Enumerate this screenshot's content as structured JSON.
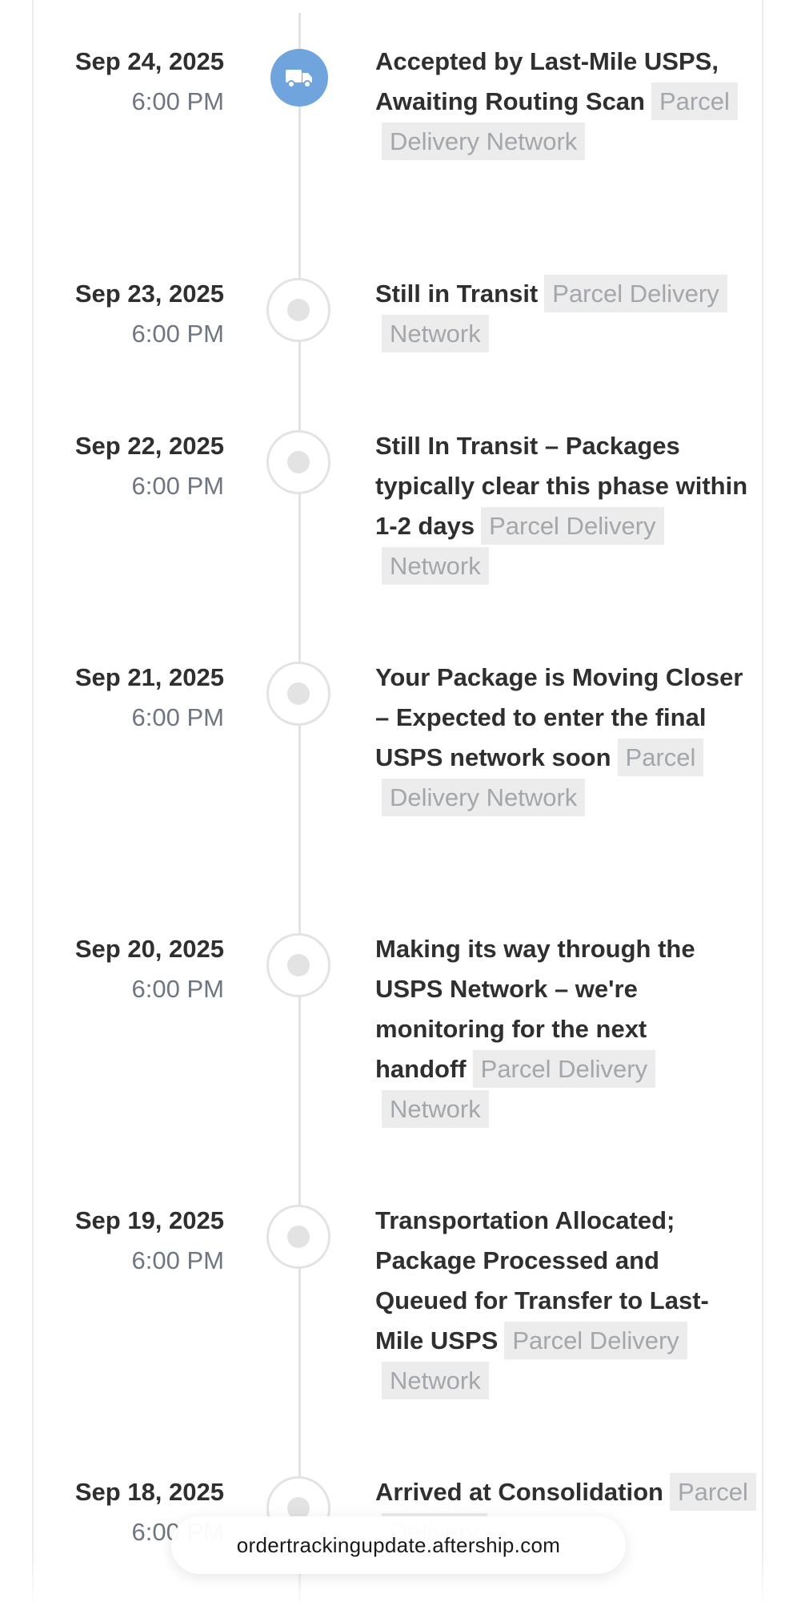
{
  "events": [
    {
      "date": "Sep 24, 2025",
      "time": "6:00 PM",
      "title": "Accepted by Last-Mile USPS, Awaiting Routing Scan",
      "courier": "Parcel Delivery Network",
      "status": "current",
      "icon": "truck-icon"
    },
    {
      "date": "Sep 23, 2025",
      "time": "6:00 PM",
      "title": "Still in Transit",
      "courier": "Parcel Delivery Network",
      "status": "past"
    },
    {
      "date": "Sep 22, 2025",
      "time": "6:00 PM",
      "title": "Still In Transit – Packages typically clear this phase within 1-2 days",
      "courier": "Parcel Delivery Network",
      "status": "past"
    },
    {
      "date": "Sep 21, 2025",
      "time": "6:00 PM",
      "title": "Your Package is Moving Closer – Expected to enter the final USPS network soon",
      "courier": "Parcel Delivery Network",
      "status": "past"
    },
    {
      "date": "Sep 20, 2025",
      "time": "6:00 PM",
      "title": "Making its way through the USPS Network – we're monitoring for the next handoff",
      "courier": "Parcel Delivery Network",
      "status": "past"
    },
    {
      "date": "Sep 19, 2025",
      "time": "6:00 PM",
      "title": "Transportation Allocated; Package Processed and Queued for Transfer to Last-Mile USPS",
      "courier": "Parcel Delivery Network",
      "status": "past"
    },
    {
      "date": "Sep 18, 2025",
      "time": "6:00 PM",
      "title": "Arrived at Consolidation",
      "courier": "Parcel Delivery",
      "status": "past"
    }
  ],
  "toast": {
    "url": "ordertrackingupdate.aftership.com"
  },
  "colors": {
    "accent": "#6fa4dd",
    "line": "#e3e3e3",
    "tag_bg": "#ececec",
    "tag_text": "#a3a7ab"
  }
}
